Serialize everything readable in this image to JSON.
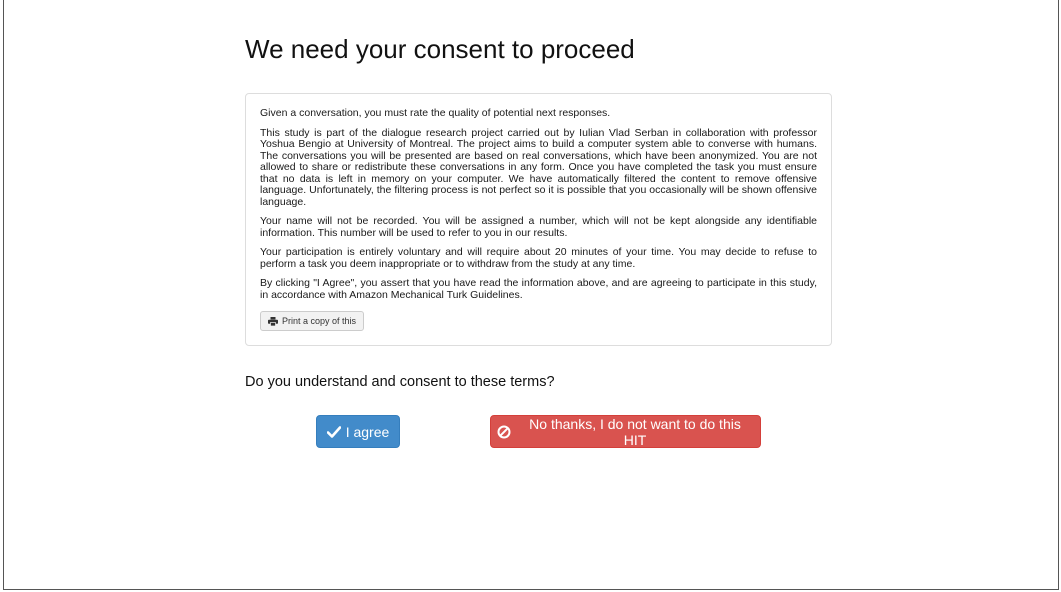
{
  "title": "We need your consent to proceed",
  "consent": {
    "paragraphs": [
      "Given a conversation, you must rate the quality of potential next responses.",
      "This study is part of the dialogue research project carried out by Iulian Vlad Serban in collaboration with professor Yoshua Bengio at University of Montreal. The project aims to build a computer system able to converse with humans. The conversations you will be presented are based on real conversations, which have been anonymized. You are not allowed to share or redistribute these conversations in any form. Once you have completed the task you must ensure that no data is left in memory on your computer. We have automatically filtered the content to remove offensive language. Unfortunately, the filtering process is not perfect so it is possible that you occasionally will be shown offensive language.",
      "Your name will not be recorded. You will be assigned a number, which will not be kept alongside any identifiable information. This number will be used to refer to you in our results.",
      "Your participation is entirely voluntary and will require about 20 minutes of your time. You may decide to refuse to perform a task you deem inappropriate or to withdraw from the study at any time.",
      "By clicking \"I Agree\", you assert that you have read the information above, and are agreeing to participate in this study, in accordance with Amazon Mechanical Turk Guidelines."
    ],
    "print_label": "Print a copy of this",
    "print_icon": "printer-icon"
  },
  "question": "Do you understand and consent to these terms?",
  "buttons": {
    "agree_label": "I agree",
    "agree_icon": "checkmark-icon",
    "agree_color": "#428bca",
    "decline_label": "No thanks, I do not want to do this HIT",
    "decline_icon": "ban-icon",
    "decline_color": "#d9534f"
  }
}
